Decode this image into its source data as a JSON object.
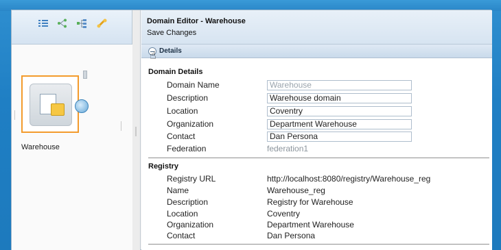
{
  "editor": {
    "title": "Domain Editor - Warehouse",
    "save_label": "Save Changes"
  },
  "details": {
    "label": "Details"
  },
  "domain_details": {
    "heading": "Domain Details",
    "fields": [
      {
        "label": "Domain Name",
        "value": "Warehouse"
      },
      {
        "label": "Description",
        "value": "Warehouse domain"
      },
      {
        "label": "Location",
        "value": "Coventry"
      },
      {
        "label": "Organization",
        "value": "Department Warehouse"
      },
      {
        "label": "Contact",
        "value": "Dan Persona"
      },
      {
        "label": "Federation",
        "value": "federation1"
      }
    ]
  },
  "registry": {
    "heading": "Registry",
    "fields": [
      {
        "label": "Registry URL",
        "value": "http://localhost:8080/registry/Warehouse_reg"
      },
      {
        "label": "Name",
        "value": "Warehouse_reg"
      },
      {
        "label": "Description",
        "value": "Registry for Warehouse"
      },
      {
        "label": "Location",
        "value": "Coventry"
      },
      {
        "label": "Organization",
        "value": "Department Warehouse"
      },
      {
        "label": "Contact",
        "value": "Dan Persona"
      }
    ]
  },
  "canvas": {
    "node_label": "Warehouse"
  },
  "toolbar": {
    "icons": [
      "list-view-icon",
      "tree-layout-icon",
      "hierarchy-layout-icon",
      "link-tool-icon"
    ]
  },
  "colors": {
    "selection": "#f39a2b",
    "header_bg": "#d7e4f1",
    "desktop_bg": "#1f7fc4"
  }
}
